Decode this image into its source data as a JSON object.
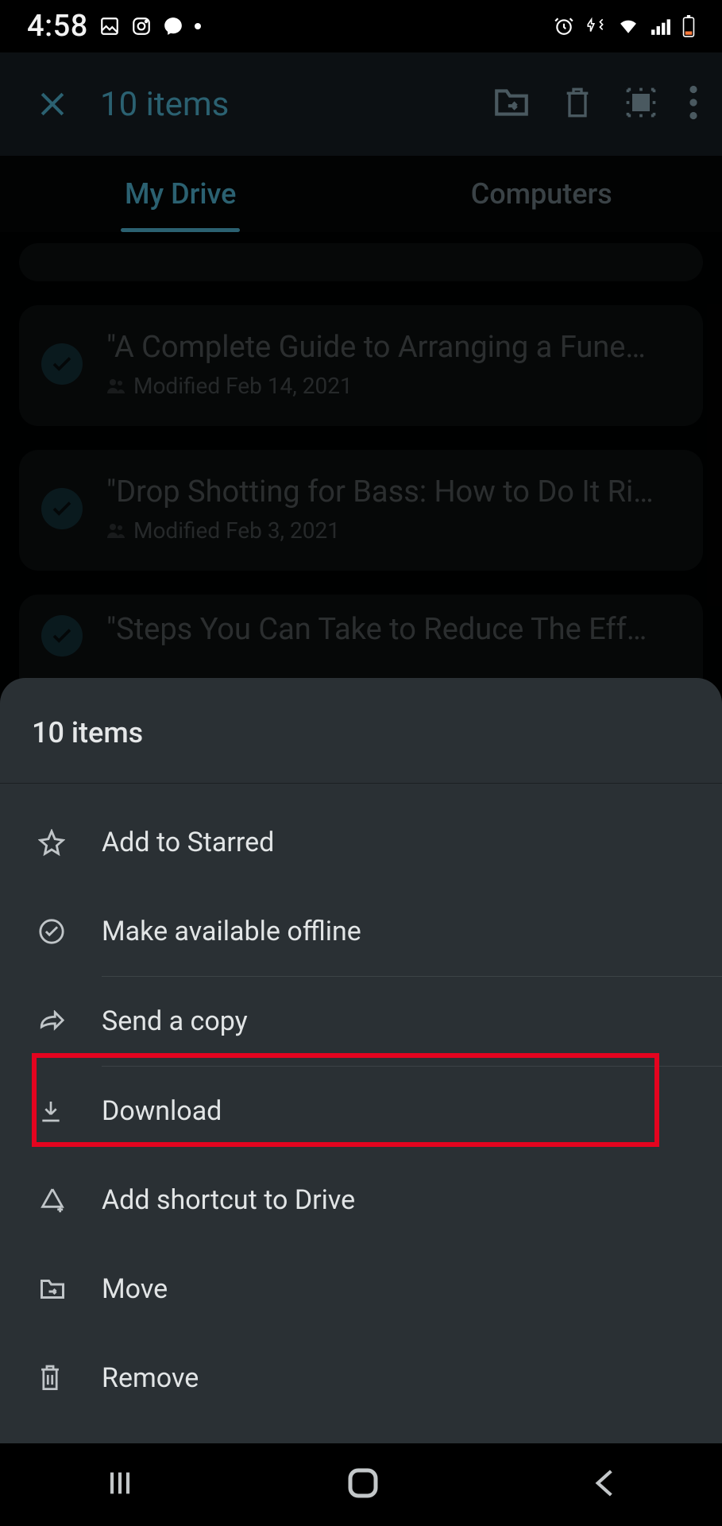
{
  "status": {
    "time": "4:58"
  },
  "selection": {
    "count_label": "10 items"
  },
  "tabs": {
    "my_drive": "My Drive",
    "computers": "Computers"
  },
  "files": [
    {
      "title": "\"A Complete Guide to Arranging a Fune…",
      "meta": "Modified Feb 14, 2021"
    },
    {
      "title": "\"Drop Shotting for Bass: How to Do It Ri…",
      "meta": "Modified Feb 3, 2021"
    },
    {
      "title": "\"Steps You Can Take to Reduce The Eff…",
      "meta": ""
    }
  ],
  "sheet": {
    "title": "10 items",
    "items": {
      "starred": "Add to Starred",
      "offline": "Make available offline",
      "sendcopy": "Send a copy",
      "download": "Download",
      "shortcut": "Add shortcut to Drive",
      "move": "Move",
      "remove": "Remove"
    }
  }
}
